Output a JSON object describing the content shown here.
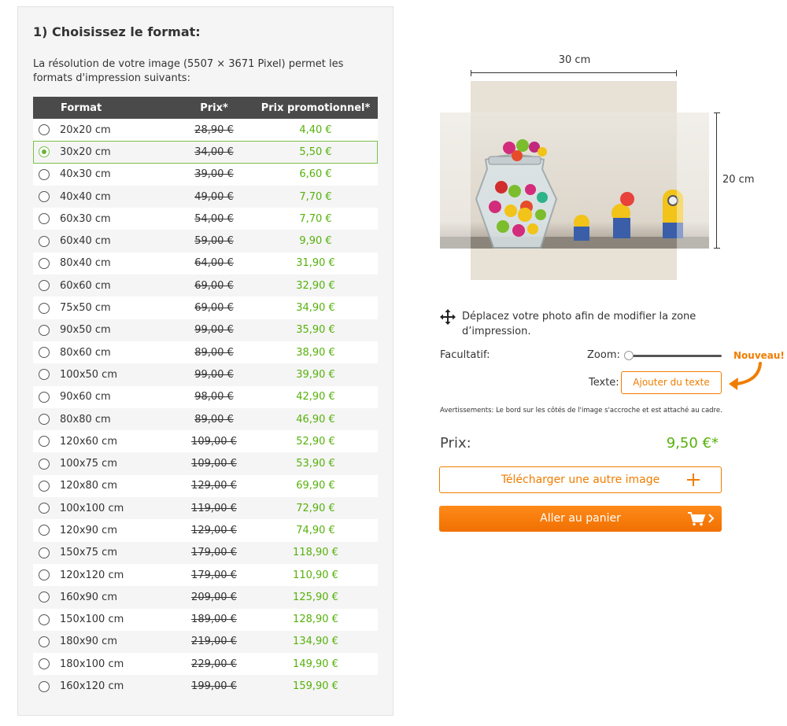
{
  "step_title": "1) Choisissez le format:",
  "intro_text": "La résolution de votre image (5507 × 3671 Pixel) permet les formats d'impression suivants:",
  "table": {
    "headers": {
      "format": "Format",
      "price": "Prix*",
      "promo": "Prix promotionnel*"
    },
    "selected_index": 1,
    "rows": [
      {
        "format": "20x20 cm",
        "price": "28,90 €",
        "promo": "4,40 €"
      },
      {
        "format": "30x20 cm",
        "price": "34,00 €",
        "promo": "5,50 €"
      },
      {
        "format": "40x30 cm",
        "price": "39,00 €",
        "promo": "6,60 €"
      },
      {
        "format": "40x40 cm",
        "price": "49,00 €",
        "promo": "7,70 €"
      },
      {
        "format": "60x30 cm",
        "price": "54,00 €",
        "promo": "7,70 €"
      },
      {
        "format": "60x40 cm",
        "price": "59,00 €",
        "promo": "9,90 €"
      },
      {
        "format": "80x40 cm",
        "price": "64,00 €",
        "promo": "31,90 €"
      },
      {
        "format": "60x60 cm",
        "price": "69,00 €",
        "promo": "32,90 €"
      },
      {
        "format": "75x50 cm",
        "price": "69,00 €",
        "promo": "34,90 €"
      },
      {
        "format": "90x50 cm",
        "price": "99,00 €",
        "promo": "35,90 €"
      },
      {
        "format": "80x60 cm",
        "price": "89,00 €",
        "promo": "38,90 €"
      },
      {
        "format": "100x50 cm",
        "price": "99,00 €",
        "promo": "39,90 €"
      },
      {
        "format": "90x60 cm",
        "price": "98,00 €",
        "promo": "42,90 €"
      },
      {
        "format": "80x80 cm",
        "price": "89,00 €",
        "promo": "46,90 €"
      },
      {
        "format": "120x60 cm",
        "price": "109,00 €",
        "promo": "52,90 €"
      },
      {
        "format": "100x75 cm",
        "price": "109,00 €",
        "promo": "53,90 €"
      },
      {
        "format": "120x80 cm",
        "price": "129,00 €",
        "promo": "69,90 €"
      },
      {
        "format": "100x100 cm",
        "price": "119,00 €",
        "promo": "72,90 €"
      },
      {
        "format": "120x90 cm",
        "price": "129,00 €",
        "promo": "74,90 €"
      },
      {
        "format": "150x75 cm",
        "price": "179,00 €",
        "promo": "118,90 €"
      },
      {
        "format": "120x120 cm",
        "price": "179,00 €",
        "promo": "110,90 €"
      },
      {
        "format": "160x90 cm",
        "price": "209,00 €",
        "promo": "125,90 €"
      },
      {
        "format": "150x100 cm",
        "price": "189,00 €",
        "promo": "128,90 €"
      },
      {
        "format": "180x90 cm",
        "price": "219,00 €",
        "promo": "134,90 €"
      },
      {
        "format": "180x100 cm",
        "price": "229,00 €",
        "promo": "149,90 €"
      },
      {
        "format": "160x120 cm",
        "price": "199,00 €",
        "promo": "159,90 €"
      }
    ]
  },
  "preview": {
    "width_label": "30 cm",
    "height_label": "20 cm",
    "move_hint": "Déplacez votre photo afin de modifier la zone d’impression."
  },
  "options": {
    "optional_label": "Facultatif:",
    "zoom_label": "Zoom:",
    "zoom_level": 0,
    "new_badge": "Nouveau!",
    "text_label": "Texte:",
    "add_text_button": "Ajouter du texte"
  },
  "warning": "Avertissements: Le bord sur les côtés de l'image s'accroche et est attaché au cadre.",
  "price": {
    "label": "Prix:",
    "value": "9,50 €*"
  },
  "buttons": {
    "upload": "Télécharger une autre image",
    "cart": "Aller au panier"
  },
  "colors": {
    "accent_orange": "#f07d00",
    "price_green": "#56b10b",
    "header_dark": "#4a4a4a"
  },
  "icons": [
    "move-icon",
    "plus-icon",
    "cart-icon",
    "chevron-right-icon",
    "curved-arrow-icon"
  ]
}
